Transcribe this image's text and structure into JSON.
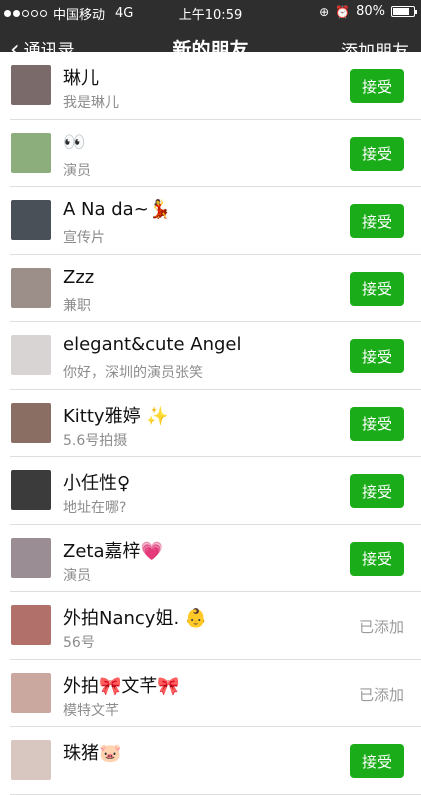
{
  "status": {
    "carrier": "中国移动",
    "network": "4G",
    "time": "上午10:59",
    "battery": "80%",
    "battery_level": 0.8
  },
  "nav": {
    "back_label": "通讯录",
    "title": "新的朋友",
    "add_label": "添加朋友"
  },
  "actions": {
    "accept": "接受",
    "added": "已添加"
  },
  "requests": [
    {
      "name": "琳儿",
      "sub": "我是琳儿",
      "state": "accept",
      "color": "#7a6a6a"
    },
    {
      "name": "👀",
      "sub": "演员",
      "state": "accept",
      "color": "#8cae7c"
    },
    {
      "name": "A Na da~💃",
      "sub": "宣传片",
      "state": "accept",
      "color": "#4a5058"
    },
    {
      "name": "Zzz",
      "sub": "兼职",
      "state": "accept",
      "color": "#9c8f8a"
    },
    {
      "name": "elegant&cute Angel",
      "sub": "你好，深圳的演员张笑",
      "state": "accept",
      "color": "#d8d4d4"
    },
    {
      "name": "Kitty雅婷 ✨",
      "sub": "5.6号拍摄",
      "state": "accept",
      "color": "#8a6e64"
    },
    {
      "name": "小任性♀",
      "sub": "地址在哪?",
      "state": "accept",
      "color": "#3b3b3b"
    },
    {
      "name": "Zeta嘉梓💗",
      "sub": "演员",
      "state": "accept",
      "color": "#9a8d94"
    },
    {
      "name": "外拍Nancy姐. 👶",
      "sub": "56号",
      "state": "added",
      "color": "#b2706b"
    },
    {
      "name": "外拍🎀文芊🎀",
      "sub": "模特文芊",
      "state": "added",
      "color": "#caa8a0"
    },
    {
      "name": "珠猪🐷",
      "sub": "",
      "state": "accept",
      "color": "#d8c7c0"
    }
  ]
}
